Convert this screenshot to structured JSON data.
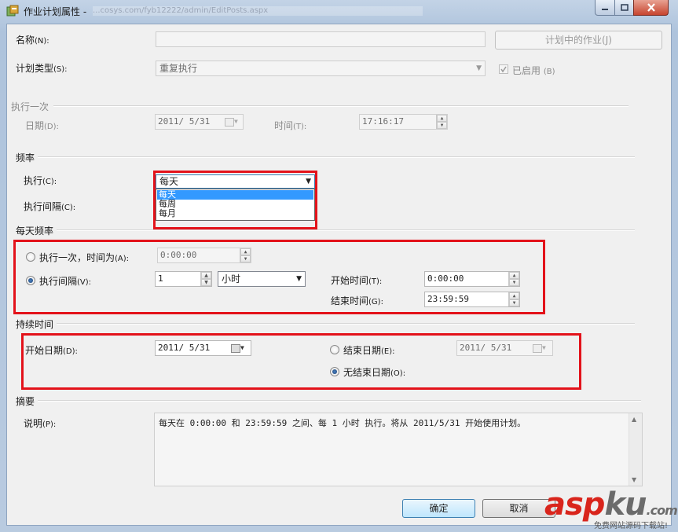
{
  "window": {
    "title": "作业计划属性 -",
    "url_fragment": "...cosys.com/fyb12222/admin/EditPosts.aspx",
    "min_icon": "minimize-icon",
    "max_icon": "maximize-icon",
    "close_icon": "close-icon"
  },
  "general": {
    "name_label": "名称",
    "name_key": "(N):",
    "name_value": "",
    "jobs_button": "计划中的作业(J)",
    "type_label": "计划类型",
    "type_key": "(S):",
    "type_value": "重复执行",
    "enabled_label": "已启用",
    "enabled_key": "(B)",
    "enabled_checked": true
  },
  "once": {
    "section": "执行一次",
    "date_label": "日期",
    "date_key": "(D):",
    "date_value": "2011/ 5/31",
    "time_label": "时间",
    "time_key": "(T):",
    "time_value": "17:16:17"
  },
  "frequency": {
    "section": "频率",
    "exec_label": "执行",
    "exec_key": "(C):",
    "exec_value": "每天",
    "interval_label": "执行间隔",
    "interval_key": "(C):",
    "options": [
      "每天",
      "每周",
      "每月"
    ],
    "selected_index": 0
  },
  "daily": {
    "section": "每天频率",
    "once_label": "执行一次，时间为",
    "once_key": "(A):",
    "once_time": "0:00:00",
    "interval_label": "执行间隔",
    "interval_key": "(V):",
    "interval_value": "1",
    "unit": "小时",
    "start_label": "开始时间",
    "start_key": "(T):",
    "start_value": "0:00:00",
    "end_label": "结束时间",
    "end_key": "(G):",
    "end_value": "23:59:59",
    "selected": "interval"
  },
  "duration": {
    "section": "持续时间",
    "start_label": "开始日期",
    "start_key": "(D):",
    "start_value": "2011/ 5/31",
    "end_label": "结束日期",
    "end_key": "(E):",
    "end_value": "2011/ 5/31",
    "noend_label": "无结束日期",
    "noend_key": "(O):",
    "selected": "noend"
  },
  "summary": {
    "section": "摘要",
    "desc_label": "说明",
    "desc_key": "(P):",
    "text": "每天在 0:00:00 和 23:59:59 之间、每 1 小时 执行。将从 2011/5/31 开始使用计划。"
  },
  "buttons": {
    "ok": "确定",
    "cancel": "取消"
  },
  "watermark": {
    "asp": "asp",
    "ku": "ku",
    "com": ".com",
    "sub": "免费网站源码下载站!"
  },
  "colors": {
    "highlight_box": "#e3121a",
    "dropdown_selection": "#3399ff",
    "watermark_red": "#d9251c",
    "watermark_gray": "#6b6b6b"
  }
}
